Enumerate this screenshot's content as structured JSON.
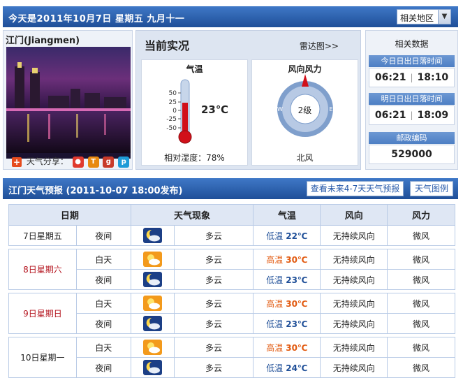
{
  "header": {
    "date_text": "今天是2011年10月7日  星期五  九月十一",
    "region_select": "相关地区",
    "region_arrow": "▼"
  },
  "city": {
    "name": "江门(Jiangmen)",
    "share_label": "天气分享："
  },
  "current": {
    "title": "当前实况",
    "radar_link": "雷达图>>",
    "temp_panel_title": "气温",
    "temperature": "23℃",
    "temperature_value": 23,
    "scale_ticks": [
      "50",
      "25",
      "0",
      "-25",
      "-50"
    ],
    "humidity": "相对湿度：78%",
    "wind_panel_title": "风向风力",
    "wind_level": "2级",
    "wind_direction": "北风",
    "compass_labels": {
      "w": "W",
      "e": "E"
    }
  },
  "related": {
    "title": "相关数据",
    "today_label": "今日日出日落时间",
    "today_sunrise": "06:21",
    "today_sunset": "18:10",
    "tomorrow_label": "明日日出日落时间",
    "tomorrow_sunrise": "06:21",
    "tomorrow_sunset": "18:09",
    "postcode_label": "邮政编码",
    "postcode": "529000",
    "sep": "|"
  },
  "forecast": {
    "title": "江门天气预报  (2011-10-07  18:00发布)",
    "btn_more": "查看未来4-7天天气预报",
    "btn_legend": "天气图例",
    "headers": [
      "日期",
      "天气现象",
      "气温",
      "风向",
      "风力"
    ],
    "rows": [
      {
        "day": "7日星期五",
        "red": false,
        "periods": [
          {
            "period": "夜间",
            "icon": "night-cloud-icon",
            "weather": "多云",
            "temp_label": "低温",
            "temp": "22℃",
            "kind": "lo",
            "wind_dir": "无持续风向",
            "wind_force": "微风"
          }
        ]
      },
      {
        "day": "8日星期六",
        "red": true,
        "periods": [
          {
            "period": "白天",
            "icon": "day-cloud-icon",
            "weather": "多云",
            "temp_label": "高温",
            "temp": "30℃",
            "kind": "hi",
            "wind_dir": "无持续风向",
            "wind_force": "微风"
          },
          {
            "period": "夜间",
            "icon": "night-cloud-icon",
            "weather": "多云",
            "temp_label": "低温",
            "temp": "23℃",
            "kind": "lo",
            "wind_dir": "无持续风向",
            "wind_force": "微风"
          }
        ]
      },
      {
        "day": "9日星期日",
        "red": true,
        "periods": [
          {
            "period": "白天",
            "icon": "day-cloud-icon",
            "weather": "多云",
            "temp_label": "高温",
            "temp": "30℃",
            "kind": "hi",
            "wind_dir": "无持续风向",
            "wind_force": "微风"
          },
          {
            "period": "夜间",
            "icon": "night-cloud-icon",
            "weather": "多云",
            "temp_label": "低温",
            "temp": "23℃",
            "kind": "lo",
            "wind_dir": "无持续风向",
            "wind_force": "微风"
          }
        ]
      },
      {
        "day": "10日星期一",
        "red": false,
        "periods": [
          {
            "period": "白天",
            "icon": "day-cloud-icon",
            "weather": "多云",
            "temp_label": "高温",
            "temp": "30℃",
            "kind": "hi",
            "wind_dir": "无持续风向",
            "wind_force": "微风"
          },
          {
            "period": "夜间",
            "icon": "night-cloud-icon",
            "weather": "多云",
            "temp_label": "低温",
            "temp": "24℃",
            "kind": "lo",
            "wind_dir": "无持续风向",
            "wind_force": "微风"
          }
        ]
      }
    ]
  }
}
